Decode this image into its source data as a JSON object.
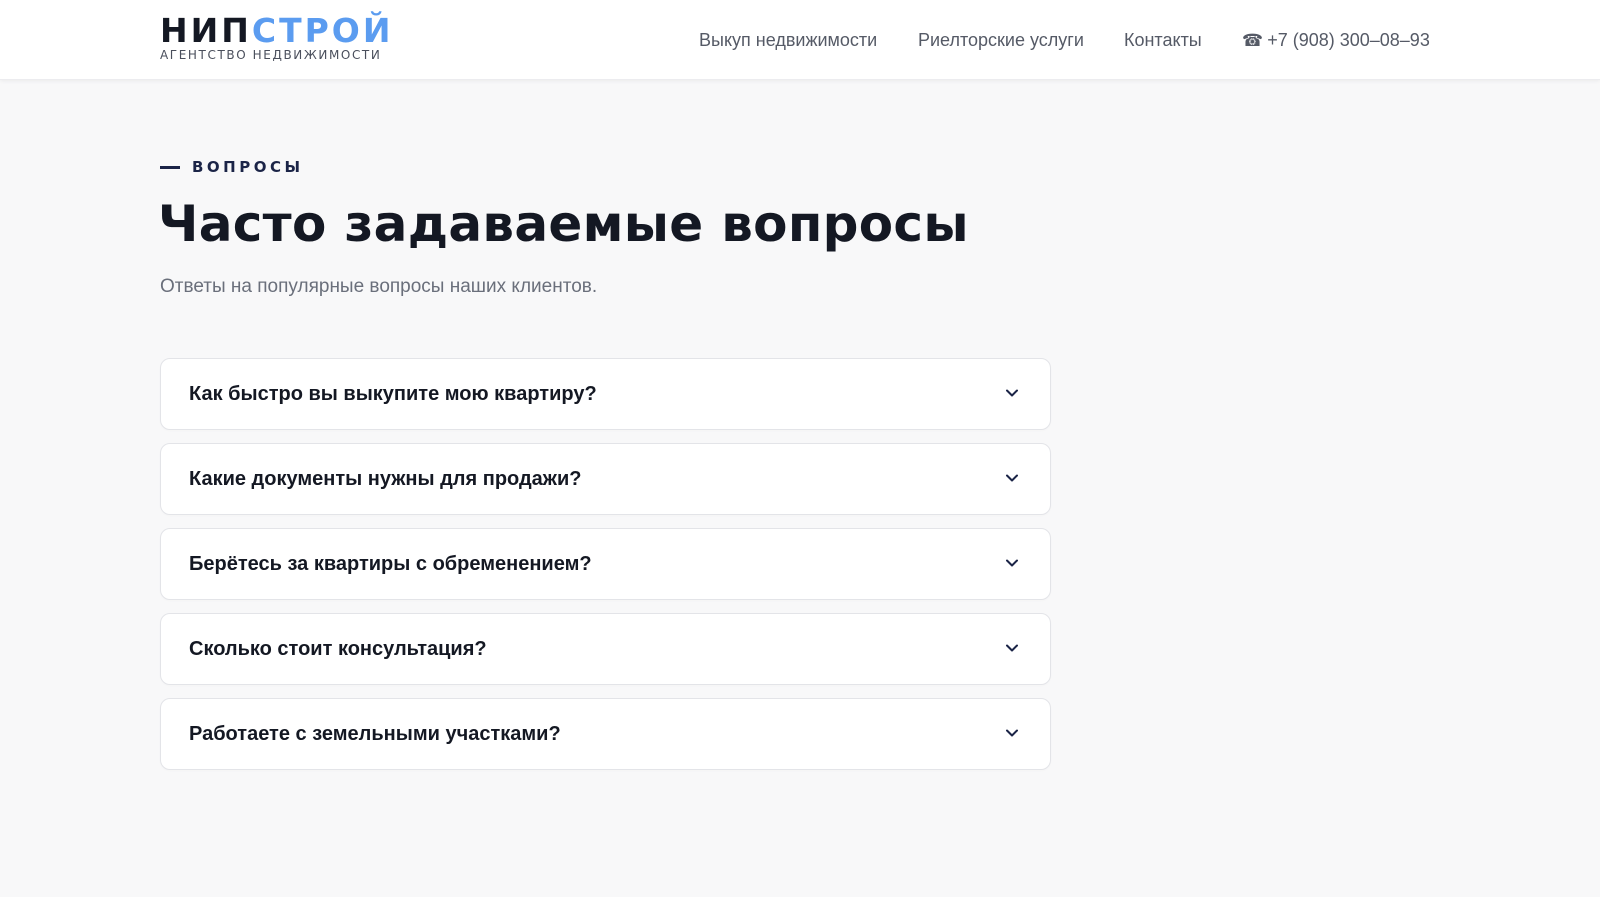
{
  "header": {
    "logo": {
      "part1": "НИП",
      "part2": "СТРОЙ",
      "subtitle": "АГЕНТСТВО НЕДВИЖИМОСТИ"
    },
    "nav": {
      "items": [
        {
          "label": "Выкуп недвижимости"
        },
        {
          "label": "Риелторские услуги"
        },
        {
          "label": "Контакты"
        }
      ],
      "phone_icon": "☎",
      "phone": "+7 (908) 300–08–93"
    }
  },
  "section": {
    "eyebrow": "ВОПРОСЫ",
    "title": "Часто задаваемые вопросы",
    "subtitle": "Ответы на популярные вопросы наших клиентов."
  },
  "faq": {
    "items": [
      {
        "question": "Как быстро вы выкупите мою квартиру?"
      },
      {
        "question": "Какие документы нужны для продажи?"
      },
      {
        "question": "Берётесь за квартиры с обременением?"
      },
      {
        "question": "Сколько стоит консультация?"
      },
      {
        "question": "Работаете с земельными участками?"
      }
    ],
    "toggle_icon": "chevron-down"
  },
  "colors": {
    "brand_dark": "#141823",
    "brand_blue": "#5b9cf0",
    "background": "#f8f8f9",
    "card": "#ffffff",
    "muted_text": "#6a6f7b"
  }
}
